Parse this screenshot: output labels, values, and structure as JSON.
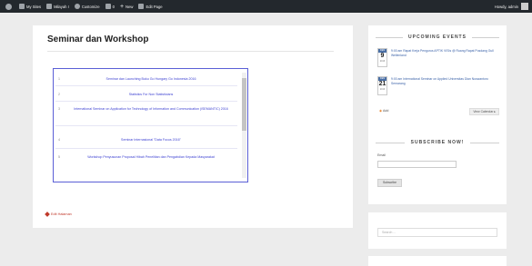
{
  "adminbar": {
    "items": [
      {
        "label": "",
        "icon": "wordpress-icon"
      },
      {
        "label": "My Sites",
        "icon": "sites-icon"
      },
      {
        "label": "Milayah I",
        "icon": "home-icon"
      },
      {
        "label": "Customize",
        "icon": "brush-icon"
      },
      {
        "label": "0",
        "icon": "comment-icon"
      },
      {
        "label": "New",
        "icon": "plus-icon"
      },
      {
        "label": "Edit Page",
        "icon": "pencil-icon"
      }
    ],
    "greeting": "Howdy, admin"
  },
  "page": {
    "title": "Seminar dan Workshop",
    "edit_label": "Edit Halaman"
  },
  "list": {
    "rows": [
      {
        "num": "1",
        "text": "Seminar dan Launching Buku Go Hungary Go Indonesia 2016"
      },
      {
        "num": "2",
        "text": "Statistics For Non Statisticians"
      },
      {
        "num": "3",
        "text": "International Seminar on Application for Technology of Information and Communication (iSEMANTIC) 2016"
      },
      {
        "num": "4",
        "text": "Seminar Internasional \"Data Focus 2016\""
      },
      {
        "num": "5",
        "text": "Workshop Penyusunan Proposal Hibah Penelitian dan Pengabdian Kepada Masyarakat"
      }
    ]
  },
  "events": {
    "heading": "UPCOMING EVENTS",
    "items": [
      {
        "month": "DES",
        "day": "9",
        "year": "2016",
        "text": "9:00 am Rapat Kerja Pengurus APTIK VISIs @ Ruang Rapat Pusdang Gull Wellenland"
      },
      {
        "month": "DES",
        "day": "21",
        "year": "2016",
        "text": "9:00 am International Seminar on Applied Universitas Dian Nuswantoro Semarang"
      }
    ],
    "feed_label": "Add",
    "view_calendar": "View Calendar"
  },
  "subscribe": {
    "heading": "SUBSCRIBE NOW!",
    "email_label": "Email",
    "button_label": "Subscribe"
  },
  "search": {
    "placeholder": "Search ..."
  }
}
